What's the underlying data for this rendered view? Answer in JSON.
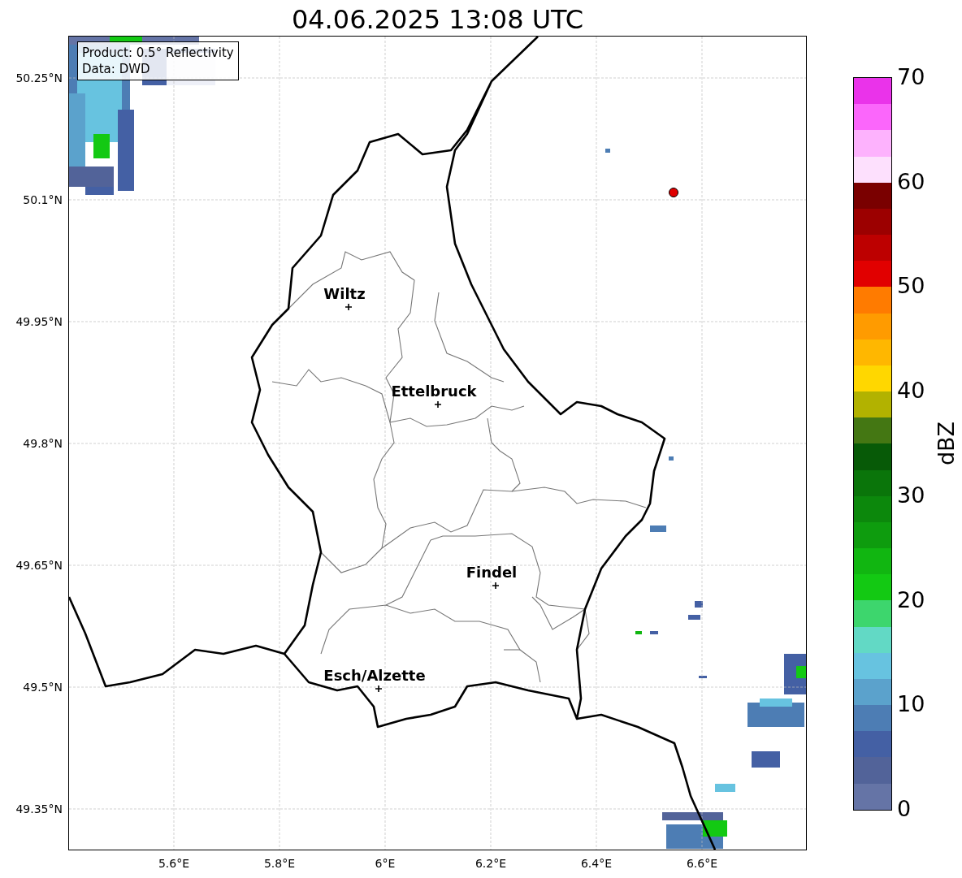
{
  "title": "04.06.2025 13:08 UTC",
  "legend": [
    "Product: 0.5° Reflectivity",
    "Data: DWD"
  ],
  "map": {
    "lat_ticks": [
      "50.25°N",
      "50.1°N",
      "49.95°N",
      "49.8°N",
      "49.65°N",
      "49.5°N",
      "49.35°N"
    ],
    "lon_ticks": [
      "5.6°E",
      "5.8°E",
      "6°E",
      "6.2°E",
      "6.4°E",
      "6.6°E"
    ],
    "places": [
      {
        "name": "Wiltz"
      },
      {
        "name": "Ettelbruck"
      },
      {
        "name": "Findel"
      },
      {
        "name": "Esch/Alzette"
      }
    ]
  },
  "colorbar": {
    "label": "dBZ",
    "ticks": [
      "70",
      "60",
      "50",
      "40",
      "30",
      "20",
      "10",
      "0"
    ],
    "segments": [
      {
        "color": "#ea33ea"
      },
      {
        "color": "#fb66fb"
      },
      {
        "color": "#fdb2fd"
      },
      {
        "color": "#fde0fd"
      },
      {
        "color": "#7a0000"
      },
      {
        "color": "#9c0000"
      },
      {
        "color": "#bd0000"
      },
      {
        "color": "#e10000"
      },
      {
        "color": "#ff7b00"
      },
      {
        "color": "#ff9b00"
      },
      {
        "color": "#ffb700"
      },
      {
        "color": "#ffd700"
      },
      {
        "color": "#b2b200"
      },
      {
        "color": "#447713"
      },
      {
        "color": "#075a07"
      },
      {
        "color": "#0a750a"
      },
      {
        "color": "#0c880c"
      },
      {
        "color": "#0e9c0e"
      },
      {
        "color": "#11b611"
      },
      {
        "color": "#13c913"
      },
      {
        "color": "#3dd66d"
      },
      {
        "color": "#62d9c5"
      },
      {
        "color": "#67c3e0"
      },
      {
        "color": "#5ba2cc"
      },
      {
        "color": "#4d7db4"
      },
      {
        "color": "#4460a4"
      },
      {
        "color": "#526399"
      },
      {
        "color": "#6574a6"
      }
    ]
  }
}
